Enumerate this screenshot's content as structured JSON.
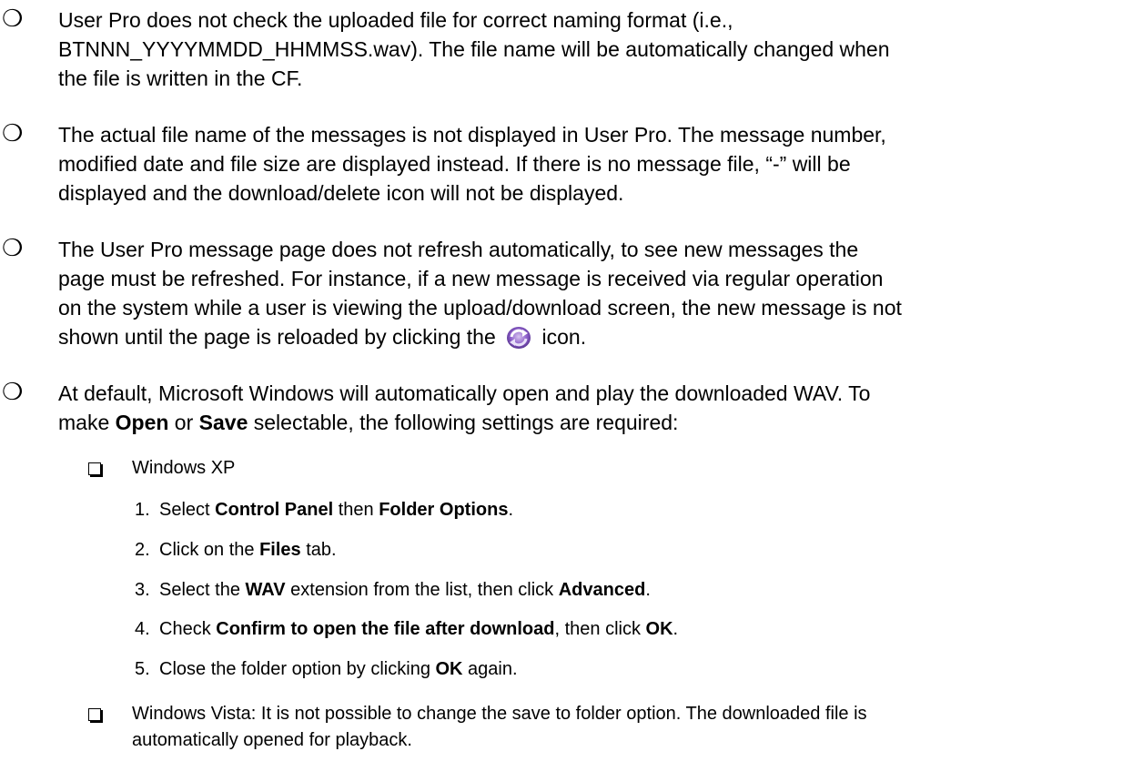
{
  "bullets": [
    {
      "line1": "User Pro does not check the uploaded file for correct naming format (i.e.,",
      "line2": "BTNNN_YYYYMMDD_HHMMSS.wav). The file name will be automatically changed when",
      "line3": "the file is written in the CF."
    },
    {
      "line1": "The actual file name of the messages is not displayed in User Pro. The message number,",
      "line2": "modified date and file size are displayed instead. If there is no message file, “-” will be",
      "line3": "displayed and the download/delete icon will not be displayed."
    },
    {
      "line1": "The User Pro message page does not refresh automatically, to see new messages the",
      "line2": "page must be refreshed. For instance, if a new message is received via regular operation",
      "line3": "on the system while a user is viewing the upload/download screen, the new message is not",
      "line4_before": "shown until the page is reloaded by clicking the",
      "line4_after": "icon.",
      "icon": "refresh-icon"
    },
    {
      "line1": "At default, Microsoft Windows will automatically open and play the downloaded WAV. To",
      "line2_a": "make ",
      "line2_b": "Open",
      "line2_c": " or ",
      "line2_d": "Save",
      "line2_e": " selectable, the following settings are required:"
    }
  ],
  "sub_xp": {
    "title": "Windows XP",
    "steps": [
      {
        "num": "1.",
        "a": "Select ",
        "b": "Control Panel",
        "c": " then ",
        "d": "Folder Options",
        "e": "."
      },
      {
        "num": "2.",
        "a": "Click on the ",
        "b": "Files",
        "c": " tab."
      },
      {
        "num": "3.",
        "a": "Select the ",
        "b": "WAV",
        "c": " extension from the list, then click ",
        "d": "Advanced",
        "e": "."
      },
      {
        "num": "4.",
        "a": "Check ",
        "b": "Confirm to open the file after download",
        "c": ", then click ",
        "d": "OK",
        "e": "."
      },
      {
        "num": "5.",
        "a": "Close the folder option by clicking ",
        "b": "OK",
        "c": " again."
      }
    ]
  },
  "sub_vista": {
    "line1": "Windows Vista: It is not possible to change the save to folder option. The downloaded file is",
    "line2": "automatically opened for playback."
  },
  "bullet_glyph": "❍"
}
